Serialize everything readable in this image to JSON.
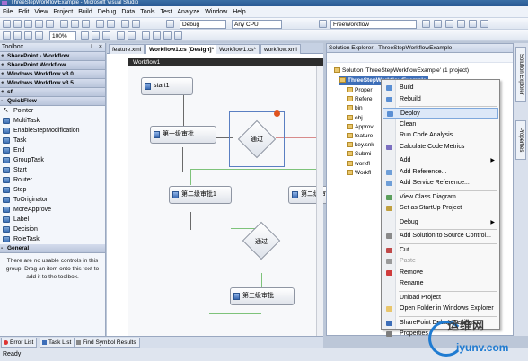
{
  "window": {
    "title": "ThreeStepWorkflowExample - Microsoft Visual Studio"
  },
  "menu": [
    "File",
    "Edit",
    "View",
    "Project",
    "Build",
    "Debug",
    "Data",
    "Tools",
    "Test",
    "Analyze",
    "Window",
    "Help"
  ],
  "toolbar": {
    "config": "Debug",
    "platform": "Any CPU",
    "project_combo": "FreeWorkflow",
    "zoom": "100%"
  },
  "toolbox": {
    "title": "Toolbox",
    "categories": [
      "SharePoint - Workflow",
      "SharePoint Workflow",
      "Windows Workflow v3.0",
      "Windows Workflow v3.5",
      "sf"
    ],
    "open_category": "QuickFlow",
    "items": [
      "Pointer",
      "MultiTask",
      "EnableStepModification",
      "Task",
      "End",
      "GroupTask",
      "Start",
      "Router",
      "Step",
      "ToOriginator",
      "MoreApprove",
      "Label",
      "Decision",
      "RoleTask"
    ],
    "general_category": "General",
    "general_text": "There are no usable controls in this group. Drag an item onto this text to add it to the toolbox."
  },
  "doc_tabs": [
    "feature.xml",
    "Workflow1.cs [Design]*",
    "Workflow1.cs*",
    "workflow.xml"
  ],
  "designer": {
    "workflow_name": "Workflow1",
    "start": "start1",
    "step1": "第一级审批",
    "decision1": "通过",
    "step2a": "第二级审批1",
    "step2b": "第二级审批",
    "decision2": "通过",
    "step3": "第三级审批"
  },
  "solution_explorer": {
    "title": "Solution Explorer - ThreeStepWorkflowExample",
    "solution": "Solution 'ThreeStepWorkflowExample' (1 project)",
    "project": "ThreeStepWorkflowExample",
    "nodes": [
      "Proper",
      "Refere",
      "bin",
      "obj",
      "Approv",
      "feature",
      "key.snk",
      "Submi",
      "workfl",
      "Workfl"
    ]
  },
  "context_menu": {
    "items": [
      {
        "label": "Build",
        "disabled": false,
        "submenu": false,
        "highlight": false
      },
      {
        "label": "Rebuild",
        "disabled": false,
        "submenu": false,
        "highlight": false
      },
      {
        "label": "Deploy",
        "disabled": false,
        "submenu": false,
        "highlight": true
      },
      {
        "label": "Clean",
        "disabled": false,
        "submenu": false,
        "highlight": false
      },
      {
        "label": "Run Code Analysis",
        "disabled": false,
        "submenu": false,
        "highlight": false
      },
      {
        "label": "Calculate Code Metrics",
        "disabled": false,
        "submenu": false,
        "highlight": false
      },
      {
        "label": "Add",
        "disabled": false,
        "submenu": true,
        "highlight": false
      },
      {
        "label": "Add Reference...",
        "disabled": false,
        "submenu": false,
        "highlight": false
      },
      {
        "label": "Add Service Reference...",
        "disabled": false,
        "submenu": false,
        "highlight": false
      },
      {
        "label": "View Class Diagram",
        "disabled": false,
        "submenu": false,
        "highlight": false
      },
      {
        "label": "Set as StartUp Project",
        "disabled": false,
        "submenu": false,
        "highlight": false
      },
      {
        "label": "Debug",
        "disabled": false,
        "submenu": true,
        "highlight": false
      },
      {
        "label": "Add Solution to Source Control...",
        "disabled": false,
        "submenu": false,
        "highlight": false
      },
      {
        "label": "Cut",
        "disabled": false,
        "submenu": false,
        "highlight": false
      },
      {
        "label": "Paste",
        "disabled": true,
        "submenu": false,
        "highlight": false
      },
      {
        "label": "Remove",
        "disabled": false,
        "submenu": false,
        "highlight": false
      },
      {
        "label": "Rename",
        "disabled": false,
        "submenu": false,
        "highlight": false
      },
      {
        "label": "Unload Project",
        "disabled": false,
        "submenu": false,
        "highlight": false
      },
      {
        "label": "Open Folder in Windows Explorer",
        "disabled": false,
        "submenu": false,
        "highlight": false
      },
      {
        "label": "SharePoint Debug Settings...",
        "disabled": false,
        "submenu": false,
        "highlight": false
      },
      {
        "label": "Properties",
        "disabled": false,
        "submenu": false,
        "highlight": false
      }
    ]
  },
  "right_tabs": [
    "Solution Explorer",
    "Properties"
  ],
  "bottom_tabs": [
    "Error List",
    "Task List",
    "Find Symbol Results"
  ],
  "status": "Ready",
  "watermark": {
    "cn": "运维网",
    "domain": "iyunv.com"
  }
}
